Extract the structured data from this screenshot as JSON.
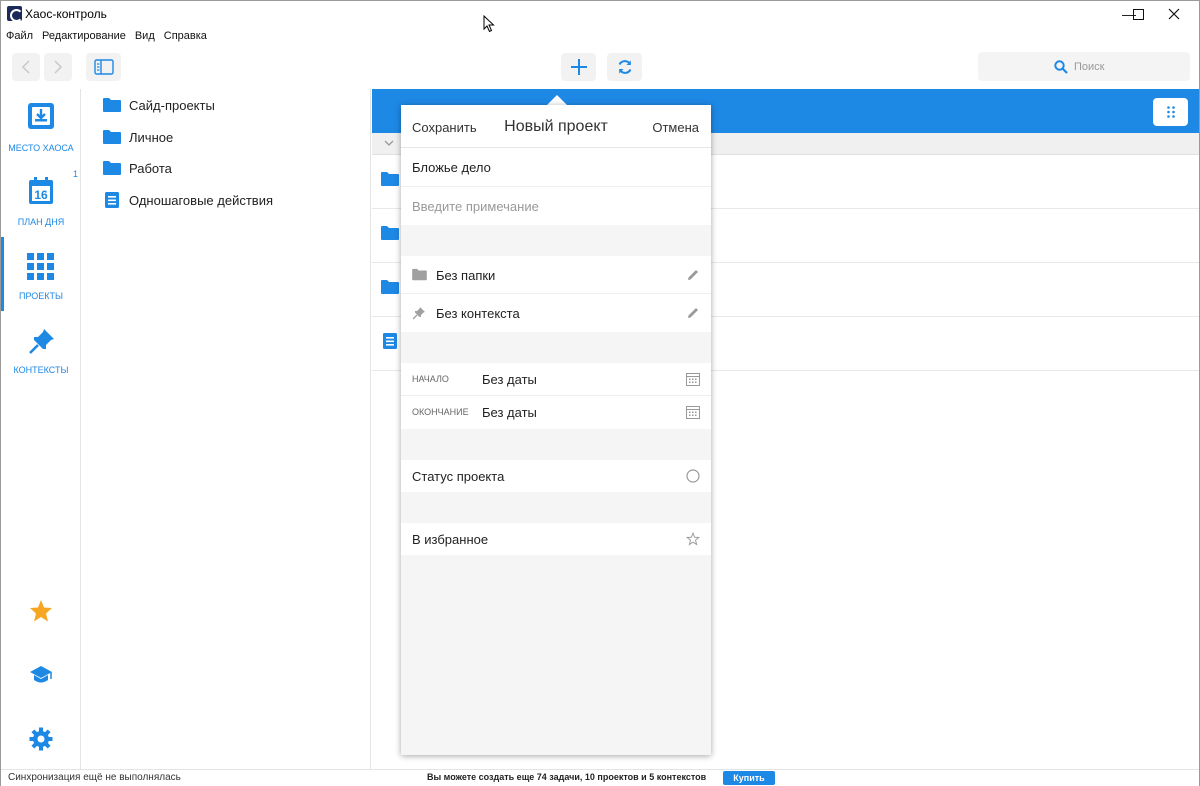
{
  "window": {
    "title": "Хаос-контроль",
    "minimize_glyph": "—",
    "maximize_glyph": "☐",
    "close_glyph": "✕"
  },
  "menu": [
    "Файл",
    "Редактирование",
    "Вид",
    "Справка"
  ],
  "toolbar": {
    "search_placeholder": "Поиск"
  },
  "leftnav": {
    "items": [
      {
        "label": "МЕСТО ХАОСА",
        "icon": "inbox-icon"
      },
      {
        "label": "ПЛАН ДНЯ",
        "icon": "calendar-icon",
        "badge": "1",
        "day": "16"
      },
      {
        "label": "ПРОЕКТЫ",
        "icon": "grid-icon"
      },
      {
        "label": "КОНТЕКСТЫ",
        "icon": "pin-icon"
      }
    ],
    "bottom_icons": [
      "star-icon",
      "graduation-cap-icon",
      "gear-icon"
    ]
  },
  "tree": {
    "items": [
      {
        "label": "Сайд-проекты",
        "icon": "folder-icon"
      },
      {
        "label": "Личное",
        "icon": "folder-icon"
      },
      {
        "label": "Работа",
        "icon": "folder-icon"
      },
      {
        "label": "Одношаговые действия",
        "icon": "list-icon"
      }
    ]
  },
  "popover": {
    "save": "Сохранить",
    "title": "Новый проект",
    "cancel": "Отмена",
    "name_value": "Бложье дело",
    "note_placeholder": "Введите примечание",
    "folder": "Без папки",
    "context": "Без контекста",
    "start_label": "НАЧАЛО",
    "start_value": "Без даты",
    "end_label": "ОКОНЧАНИЕ",
    "end_value": "Без даты",
    "status": "Статус проекта",
    "favorite": "В избранное"
  },
  "status": {
    "sync": "Синхронизация ещё не выполнялась",
    "limits": "Вы можете создать еще 74 задачи, 10 проектов и 5 контекстов",
    "buy": "Купить"
  },
  "colors": {
    "accent": "#1e88e5",
    "star": "#f5a623"
  }
}
